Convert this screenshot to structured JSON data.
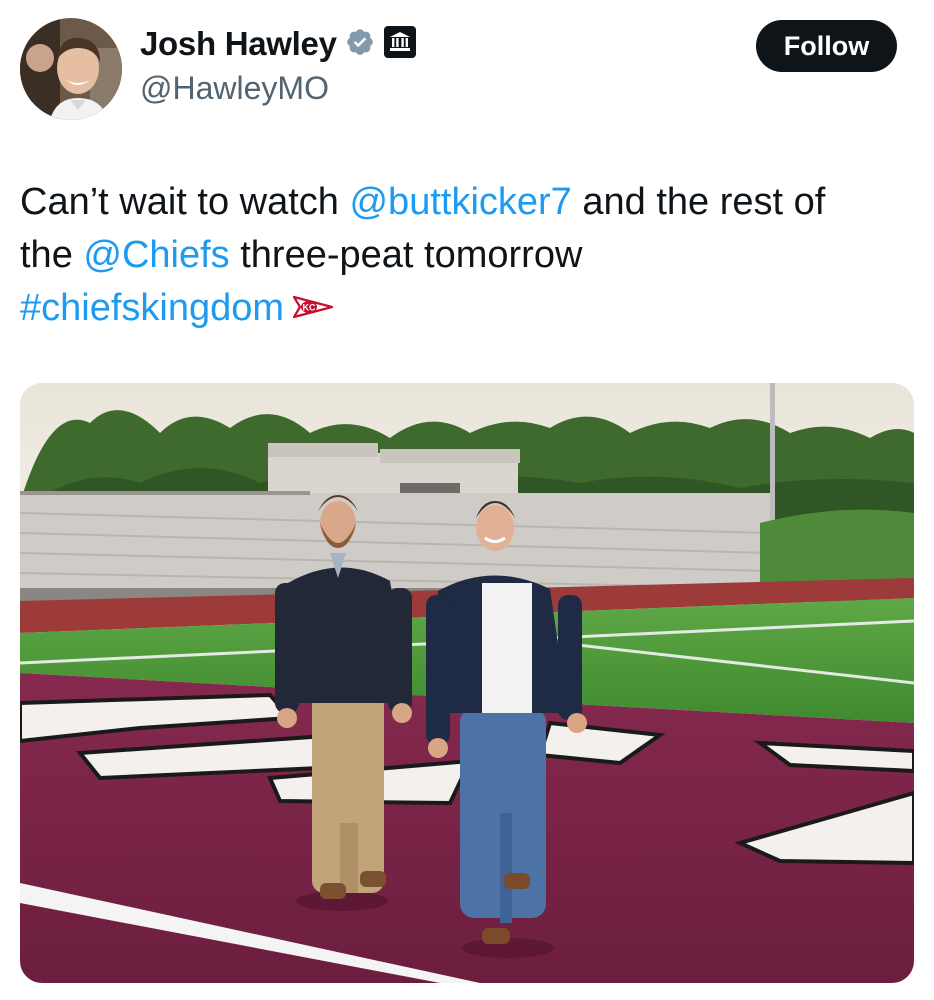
{
  "author": {
    "display_name": "Josh Hawley",
    "handle": "@HawleyMO",
    "verified_badge_icon": "verified-badge-icon",
    "affiliation_icon": "government-building-icon",
    "avatar_alt": "Josh Hawley"
  },
  "actions": {
    "follow_label": "Follow"
  },
  "tweet": {
    "text_line1_pre": "Can’t wait to watch ",
    "mention1": "@buttkicker7",
    "text_line1_post": " and the rest of",
    "text_line2_pre": "the ",
    "mention2": "@Chiefs",
    "text_line2_post": " three-peat tomorrow",
    "hashtag": "#chiefskingdom",
    "hashtag_emoji_icon": "chiefs-arrowhead-icon"
  },
  "media": {
    "alt": "Two men walking across a football field end zone",
    "endzone_color": "#7a2346",
    "turf_color": "#4f9a3a"
  },
  "colors": {
    "link": "#1d9bf0",
    "text": "#0f1419",
    "secondary": "#536471",
    "button_bg": "#0f1419"
  }
}
